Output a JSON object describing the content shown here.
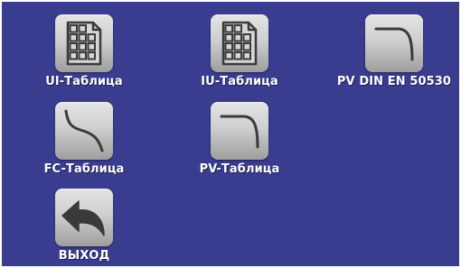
{
  "menu": {
    "items": [
      {
        "label": "UI-Таблица",
        "icon": "table-icon"
      },
      {
        "label": "IU-Таблица",
        "icon": "table-icon"
      },
      {
        "label": "PV DIN EN 50530",
        "icon": "pv-curve-icon"
      },
      {
        "label": "FC-Таблица",
        "icon": "fc-curve-icon"
      },
      {
        "label": "PV-Таблица",
        "icon": "pv-curve-icon"
      },
      {
        "label": "ВЫХОД",
        "icon": "back-arrow-icon"
      }
    ]
  },
  "colors": {
    "background": "#3a3d8f",
    "label": "#ffffff",
    "button_face": "#d0d0d0",
    "icon_stroke": "#3a3a3a"
  }
}
